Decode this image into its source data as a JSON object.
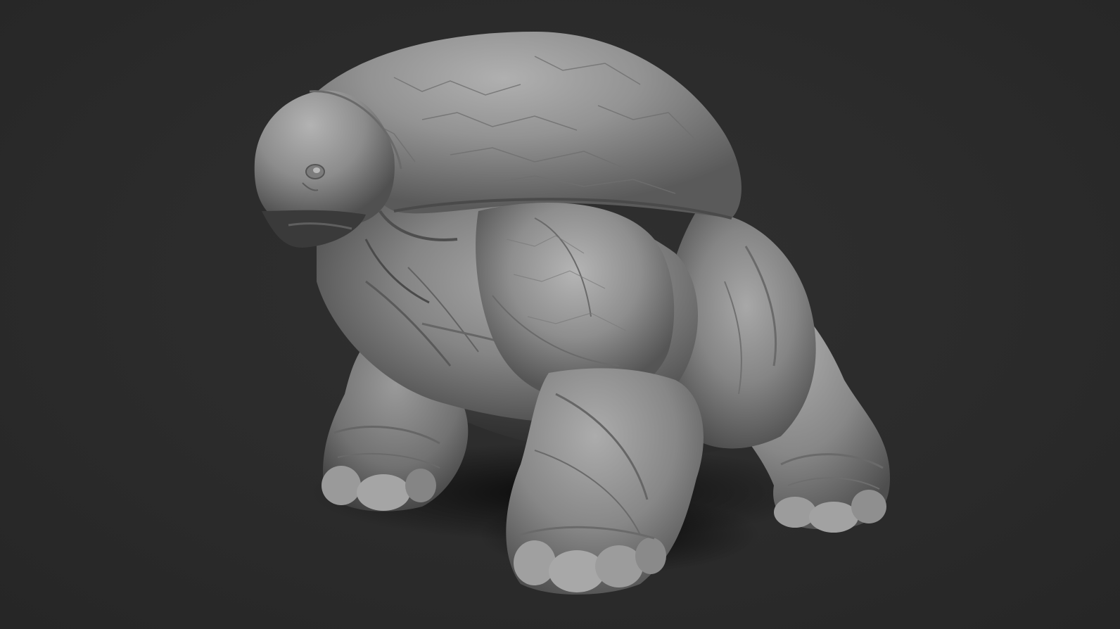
{
  "scene": {
    "background_color": "#2b2b2b",
    "material_color": "#8f8f8f",
    "subject_icon": "sculpted-creature-render"
  }
}
